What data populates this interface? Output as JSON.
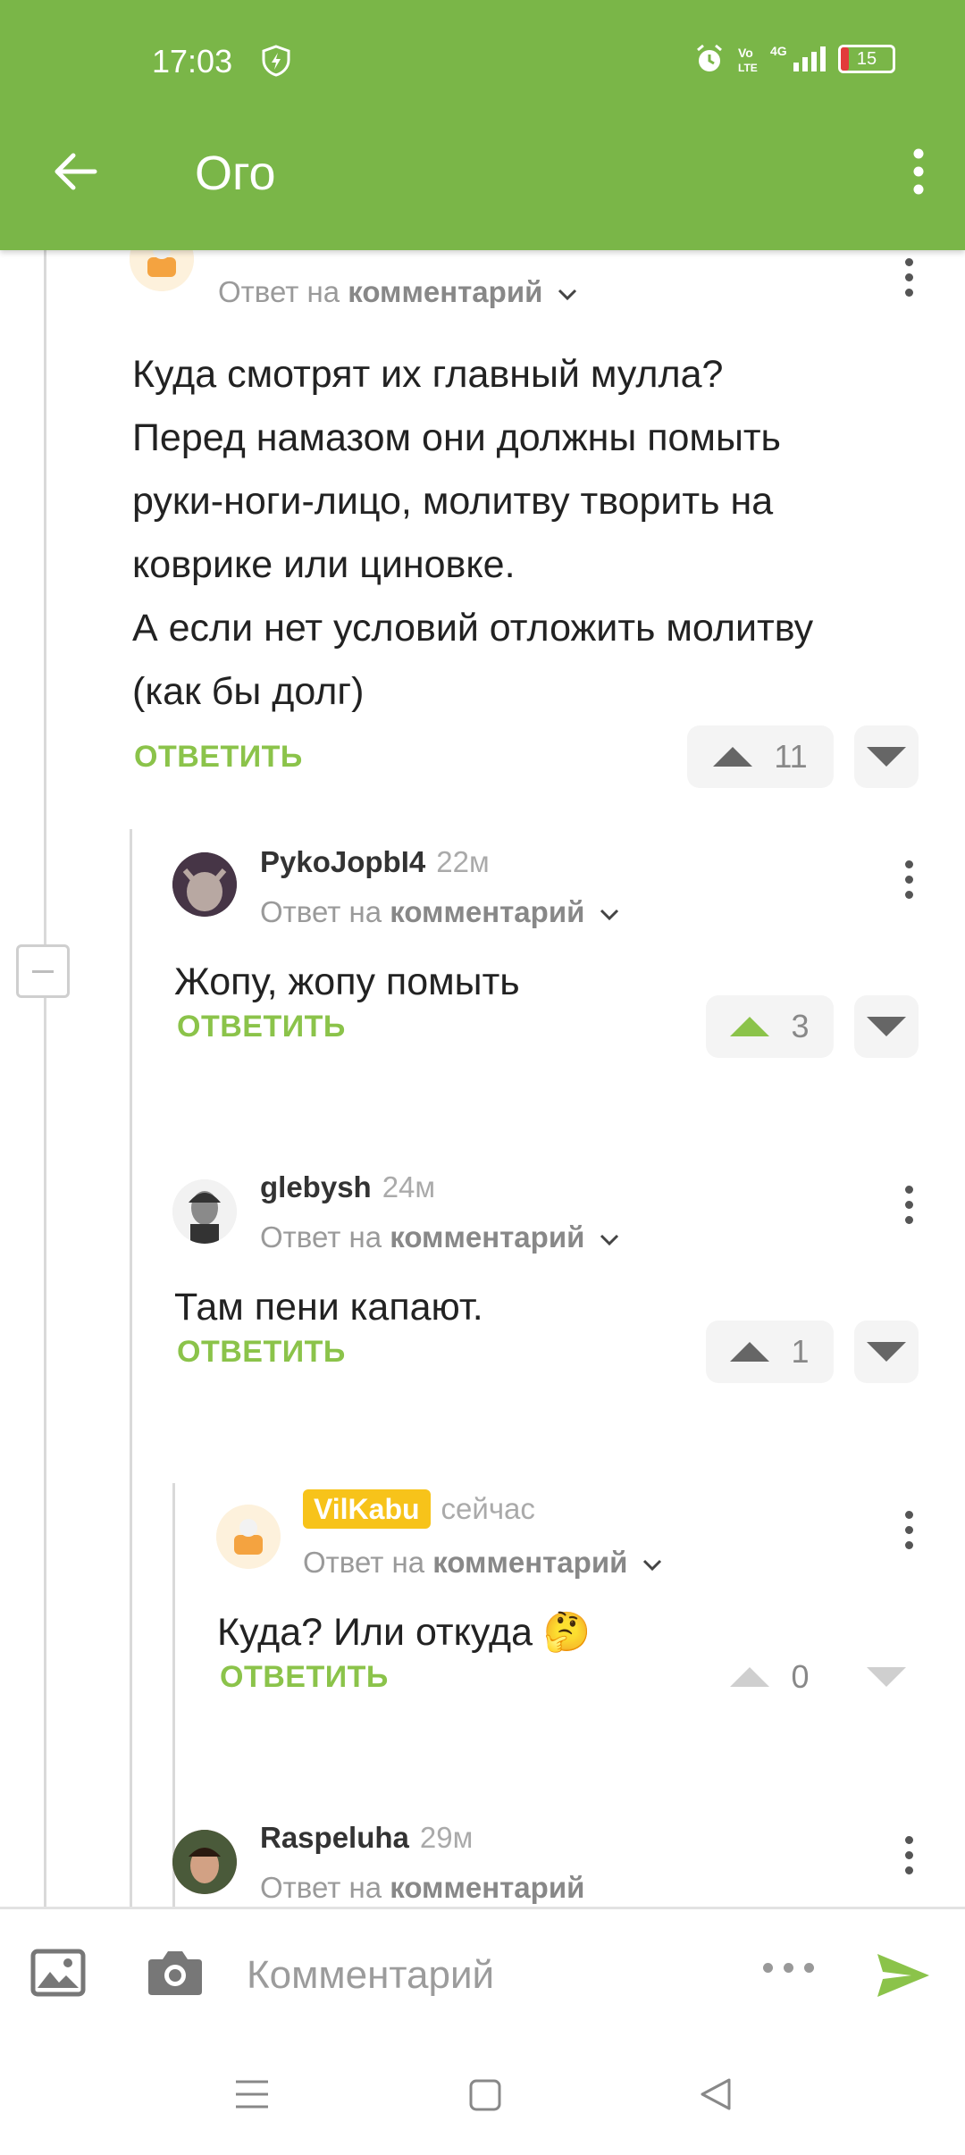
{
  "status": {
    "time": "17:03",
    "battery": "15",
    "battery_percent": 15,
    "network": "4G"
  },
  "header": {
    "title": "Ого"
  },
  "comments": [
    {
      "author": "",
      "time": "",
      "reply_prefix": "Ответ на",
      "reply_target": "комментарий",
      "text_lines": [
        "Куда смотрят их главный мулла?",
        "Перед намазом они должны помыть",
        "руки-ноги-лицо, молитву творить на",
        "коврике или циновке.",
        "А если нет условий отложить молитву",
        "(как бы долг)"
      ],
      "reply_label": "ОТВЕТИТЬ",
      "votes": "11"
    },
    {
      "author": "PykoJopbI4",
      "time": "22м",
      "reply_prefix": "Ответ на",
      "reply_target": "комментарий",
      "text": "Жопу, жопу помыть",
      "reply_label": "ОТВЕТИТЬ",
      "votes": "3"
    },
    {
      "author": "glebysh",
      "time": "24м",
      "reply_prefix": "Ответ на",
      "reply_target": "комментарий",
      "text": "Там пени капают.",
      "reply_label": "ОТВЕТИТЬ",
      "votes": "1"
    },
    {
      "author": "VilKabu",
      "time": "сейчас",
      "reply_prefix": "Ответ на",
      "reply_target": "комментарий",
      "text": "Куда? Или откуда 🤔",
      "reply_label": "ОТВЕТИТЬ",
      "votes": "0"
    },
    {
      "author": "Raspeluha",
      "time": "29м",
      "reply_prefix": "Ответ на",
      "reply_target": "комментарий"
    }
  ],
  "input": {
    "placeholder": "Комментарий"
  },
  "colors": {
    "brand": "#7ab648",
    "accent": "#8bc34a",
    "badge": "#f7c31a"
  },
  "icons": [
    "shield-icon",
    "alarm-icon",
    "signal-icon",
    "battery-icon",
    "back-arrow-icon",
    "more-vert-icon",
    "image-icon",
    "camera-icon",
    "send-icon",
    "nav-menu-icon",
    "nav-home-icon",
    "nav-back-icon"
  ]
}
